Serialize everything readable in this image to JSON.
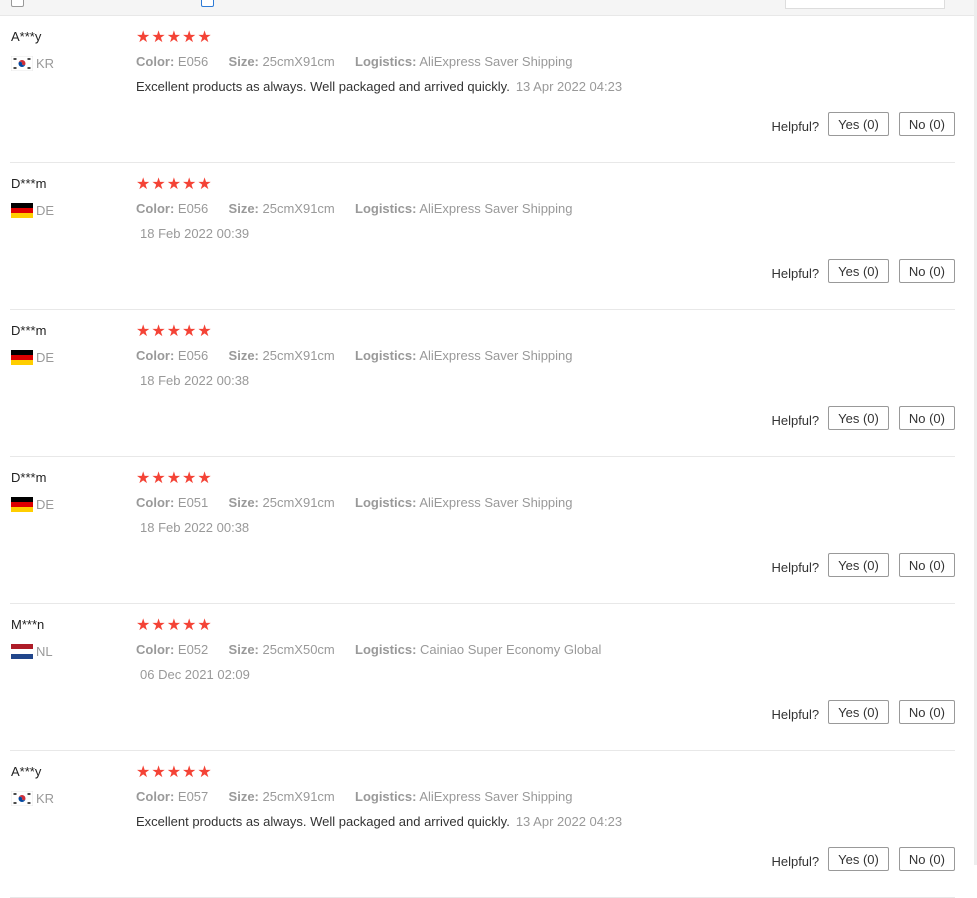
{
  "meta_labels": {
    "color": "Color:",
    "size": "Size:",
    "logistics": "Logistics:"
  },
  "helpful_label": "Helpful?",
  "reviews": [
    {
      "user": "A***y",
      "country": "KR",
      "flag": "kr-flag-icon",
      "stars": "★★★★★",
      "color": "E056",
      "size": "25cmX91cm",
      "logistics": "AliExpress Saver Shipping",
      "text": "Excellent products as always. Well packaged and arrived quickly.",
      "date": "13 Apr 2022 04:23",
      "yes": "Yes (0)",
      "no": "No (0)"
    },
    {
      "user": "D***m",
      "country": "DE",
      "flag": "de-flag-icon",
      "stars": "★★★★★",
      "color": "E056",
      "size": "25cmX91cm",
      "logistics": "AliExpress Saver Shipping",
      "text": "",
      "date": "18 Feb 2022 00:39",
      "yes": "Yes (0)",
      "no": "No (0)"
    },
    {
      "user": "D***m",
      "country": "DE",
      "flag": "de-flag-icon",
      "stars": "★★★★★",
      "color": "E056",
      "size": "25cmX91cm",
      "logistics": "AliExpress Saver Shipping",
      "text": "",
      "date": "18 Feb 2022 00:38",
      "yes": "Yes (0)",
      "no": "No (0)"
    },
    {
      "user": "D***m",
      "country": "DE",
      "flag": "de-flag-icon",
      "stars": "★★★★★",
      "color": "E051",
      "size": "25cmX91cm",
      "logistics": "AliExpress Saver Shipping",
      "text": "",
      "date": "18 Feb 2022 00:38",
      "yes": "Yes (0)",
      "no": "No (0)"
    },
    {
      "user": "M***n",
      "country": "NL",
      "flag": "nl-flag-icon",
      "stars": "★★★★★",
      "color": "E052",
      "size": "25cmX50cm",
      "logistics": "Cainiao Super Economy Global",
      "text": "",
      "date": "06 Dec 2021 02:09",
      "yes": "Yes (0)",
      "no": "No (0)"
    },
    {
      "user": "A***y",
      "country": "KR",
      "flag": "kr-flag-icon",
      "stars": "★★★★★",
      "color": "E057",
      "size": "25cmX91cm",
      "logistics": "AliExpress Saver Shipping",
      "text": "Excellent products as always. Well packaged and arrived quickly.",
      "date": "13 Apr 2022 04:23",
      "yes": "Yes (0)",
      "no": "No (0)"
    }
  ],
  "colors": {
    "star": "#f44336",
    "muted": "#999999",
    "text": "#333333",
    "divider": "#e8e8e8"
  }
}
